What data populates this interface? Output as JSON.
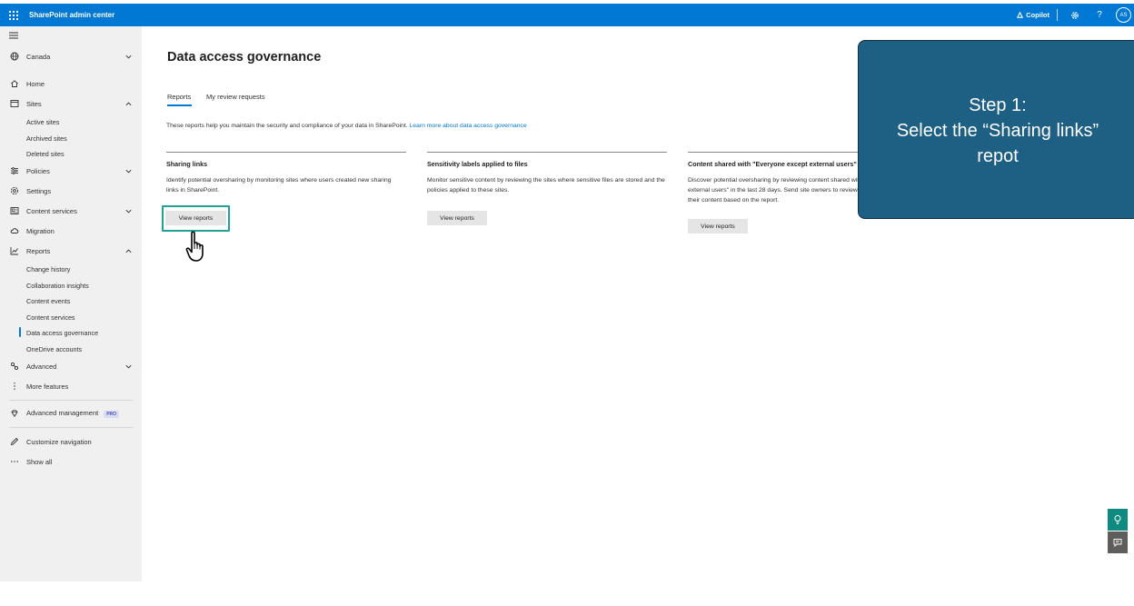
{
  "topbar": {
    "app_title": "SharePoint admin center",
    "copilot_label": "Copilot",
    "help_label": "?",
    "avatar_initials": "AS",
    "color": "#0078d4"
  },
  "sidebar": {
    "region": "Canada",
    "items": {
      "home": "Home",
      "sites": "Sites",
      "active_sites": "Active sites",
      "archived_sites": "Archived sites",
      "deleted_sites": "Deleted sites",
      "policies": "Policies",
      "settings": "Settings",
      "content_services": "Content services",
      "migration": "Migration",
      "reports": "Reports",
      "change_history": "Change history",
      "collaboration_insights": "Collaboration insights",
      "content_events": "Content events",
      "content_services_sub": "Content services",
      "data_access_governance": "Data access governance",
      "onedrive_accounts": "OneDrive accounts",
      "advanced": "Advanced",
      "more_features": "More features",
      "advanced_management": "Advanced management",
      "pro_badge": "PRO",
      "customize_navigation": "Customize navigation",
      "show_all": "Show all"
    }
  },
  "main": {
    "title": "Data access governance",
    "tabs": [
      "Reports",
      "My review requests"
    ],
    "intro_text": "These reports help you maintain the security and compliance of your data in SharePoint. ",
    "intro_link": "Learn more about data access governance",
    "cards": [
      {
        "title": "Sharing links",
        "desc": "Identify potential oversharing by monitoring sites where users created new sharing links in SharePoint.",
        "button": "View reports"
      },
      {
        "title": "Sensitivity labels applied to files",
        "desc": "Monitor sensitive content by reviewing the sites where sensitive files are stored and the policies applied to these sites.",
        "button": "View reports"
      },
      {
        "title": "Content shared with \"Everyone except external users\"",
        "desc": "Discover potential oversharing by reviewing content shared with \"Everyone except external users\" in the last 28 days. Send site owners to review access permissions of their content based on the report.",
        "button": "View reports"
      }
    ]
  },
  "callout": {
    "line1": "Step 1:",
    "line2": "Select the “Sharing links”",
    "line3": "repot",
    "color": "#1e5f84"
  },
  "icons": {
    "waffle": "app-launcher-icon",
    "hamburger": "menu-icon",
    "globe": "globe-icon",
    "home": "home-icon",
    "sites": "sites-icon",
    "policies": "policies-icon",
    "settings": "gear-icon",
    "content_services": "content-services-icon",
    "migration": "cloud-icon",
    "reports": "chart-icon",
    "advanced": "advanced-icon",
    "more": "more-vertical-icon",
    "advanced_management": "diamond-icon",
    "customize": "pencil-icon",
    "show_all": "ellipsis-icon",
    "cursor": "hand-pointer-icon"
  }
}
